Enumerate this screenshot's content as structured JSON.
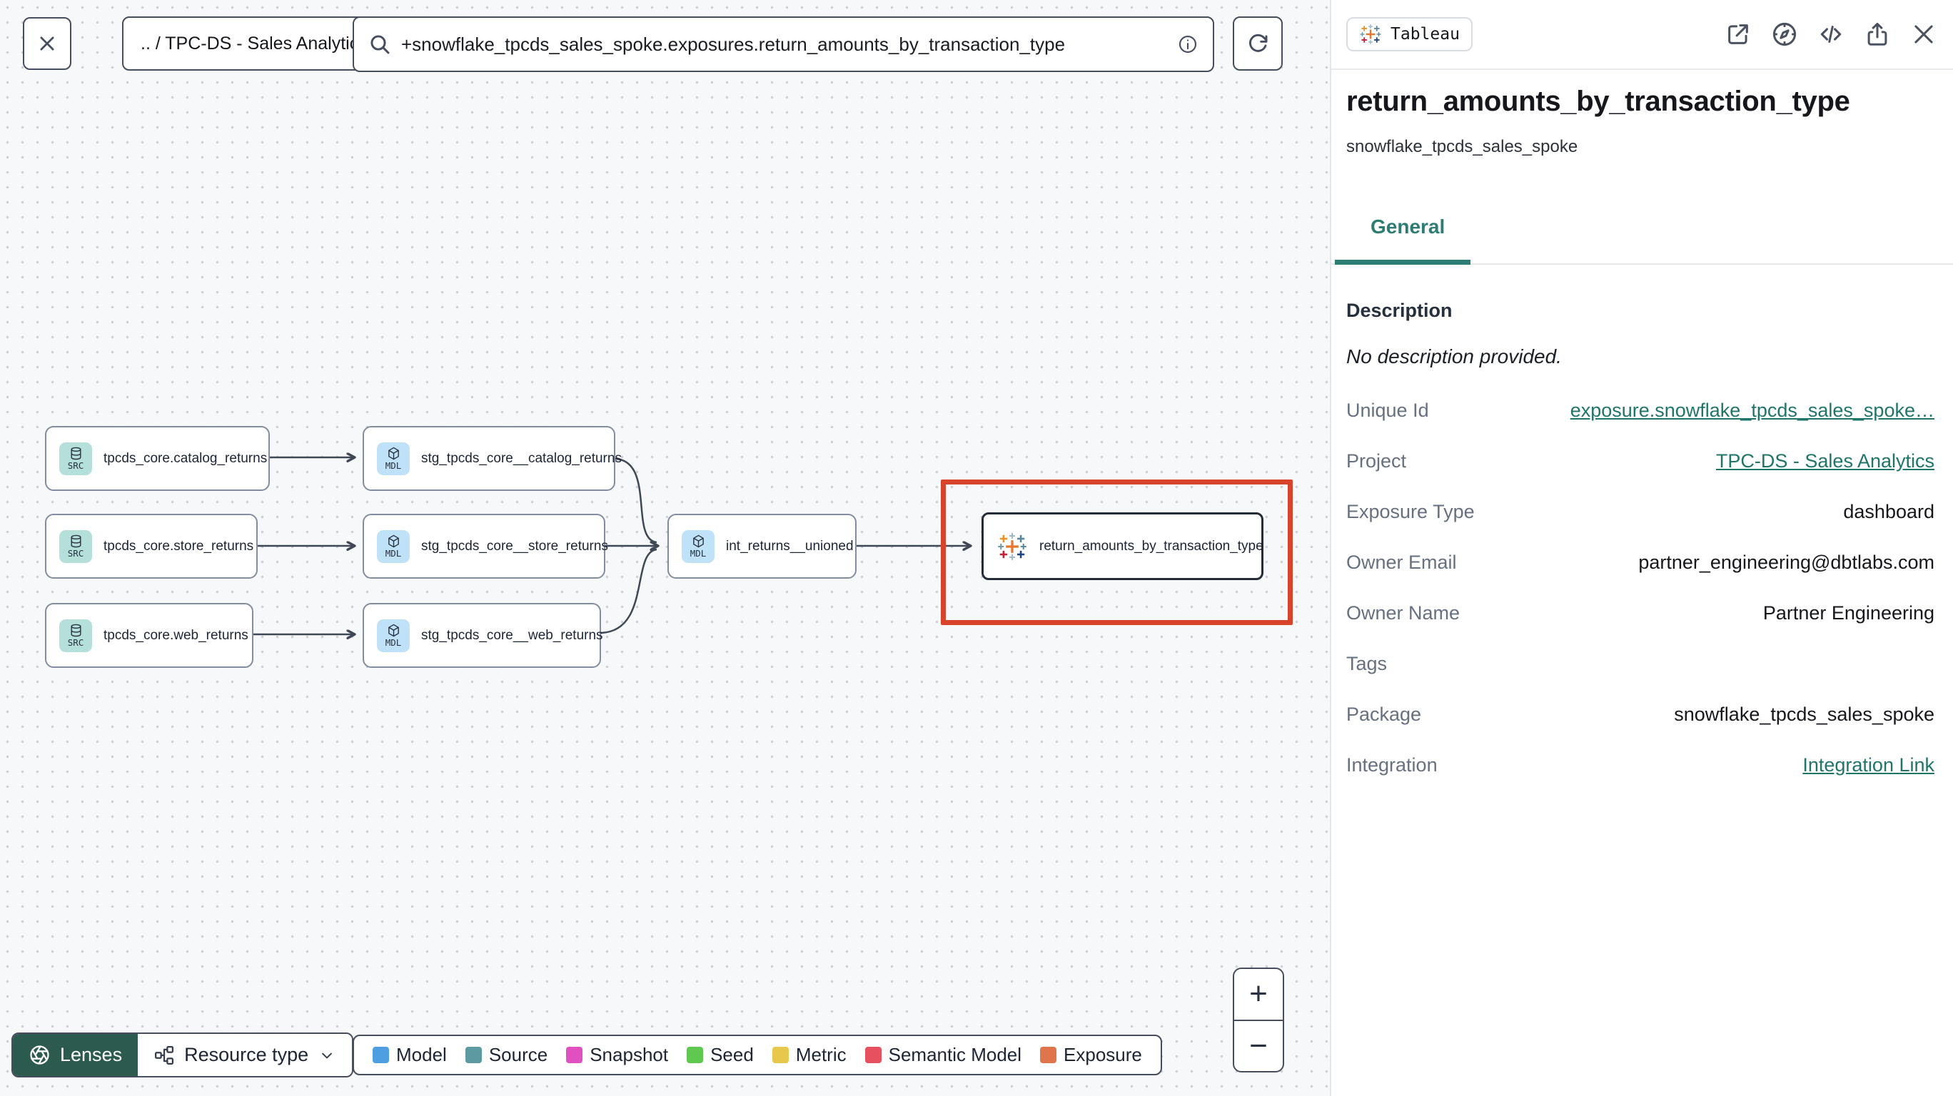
{
  "topbar": {
    "breadcrumb": ".. / TPC-DS - Sales Analytics",
    "search_value": "+snowflake_tpcds_sales_spoke.exposures.return_amounts_by_transaction_type"
  },
  "canvas": {
    "nodes": [
      {
        "label": "tpcds_core.catalog_returns",
        "badge": "SRC"
      },
      {
        "label": "stg_tpcds_core__catalog_returns",
        "badge": "MDL"
      },
      {
        "label": "tpcds_core.store_returns",
        "badge": "SRC"
      },
      {
        "label": "stg_tpcds_core__store_returns",
        "badge": "MDL"
      },
      {
        "label": "tpcds_core.web_returns",
        "badge": "SRC"
      },
      {
        "label": "stg_tpcds_core__web_returns",
        "badge": "MDL"
      },
      {
        "label": "int_returns__unioned",
        "badge": "MDL"
      },
      {
        "label": "return_amounts_by_transaction_type"
      }
    ],
    "lenses_label": "Lenses",
    "resource_type_label": "Resource type",
    "zoom_in_label": "+",
    "zoom_out_label": "−",
    "legend": {
      "items": [
        {
          "label": "Model",
          "color": "#4e9fe1"
        },
        {
          "label": "Source",
          "color": "#5b9aa0"
        },
        {
          "label": "Snapshot",
          "color": "#e050c0"
        },
        {
          "label": "Seed",
          "color": "#5ec94e"
        },
        {
          "label": "Metric",
          "color": "#e8c84a"
        },
        {
          "label": "Semantic Model",
          "color": "#e6505f"
        },
        {
          "label": "Exposure",
          "color": "#e0744a"
        }
      ]
    }
  },
  "panel": {
    "integration_badge": "Tableau",
    "title": "return_amounts_by_transaction_type",
    "subtitle": "snowflake_tpcds_sales_spoke",
    "tab_general": "General",
    "description_label": "Description",
    "description_value": "No description provided.",
    "fields": [
      {
        "label": "Unique Id",
        "value": "exposure.snowflake_tpcds_sales_spoke…",
        "link": true
      },
      {
        "label": "Project",
        "value": "TPC-DS - Sales Analytics",
        "link": true
      },
      {
        "label": "Exposure Type",
        "value": "dashboard",
        "link": false
      },
      {
        "label": "Owner Email",
        "value": "partner_engineering@dbtlabs.com",
        "link": false
      },
      {
        "label": "Owner Name",
        "value": "Partner Engineering",
        "link": false
      },
      {
        "label": "Tags",
        "value": "",
        "link": false
      },
      {
        "label": "Package",
        "value": "snowflake_tpcds_sales_spoke",
        "link": false
      },
      {
        "label": "Integration",
        "value": "Integration Link",
        "link": true
      }
    ]
  }
}
